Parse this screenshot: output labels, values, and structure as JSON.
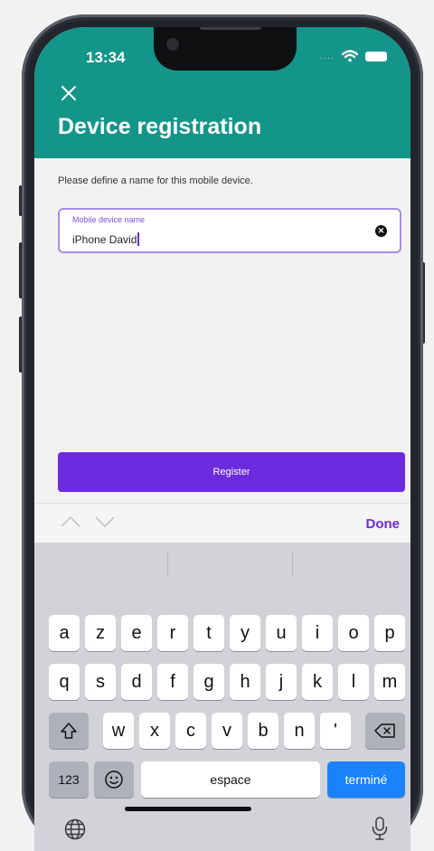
{
  "status_bar": {
    "time": "13:34",
    "signal": "...."
  },
  "header": {
    "title": "Device registration"
  },
  "content": {
    "hint": "Please define a name for this mobile device.",
    "field": {
      "label": "Mobile device name",
      "value": "iPhone David"
    },
    "register_label": "Register"
  },
  "toolbar": {
    "done_label": "Done"
  },
  "keyboard": {
    "row1": [
      "a",
      "z",
      "e",
      "r",
      "t",
      "y",
      "u",
      "i",
      "o",
      "p"
    ],
    "row2": [
      "q",
      "s",
      "d",
      "f",
      "g",
      "h",
      "j",
      "k",
      "l",
      "m"
    ],
    "row3": [
      "w",
      "x",
      "c",
      "v",
      "b",
      "n",
      "'"
    ],
    "numbers_label": "123",
    "space_label": "espace",
    "return_label": "terminé"
  },
  "colors": {
    "header": "#14958a",
    "accent": "#6c2bde",
    "return_key": "#1a82fb"
  }
}
